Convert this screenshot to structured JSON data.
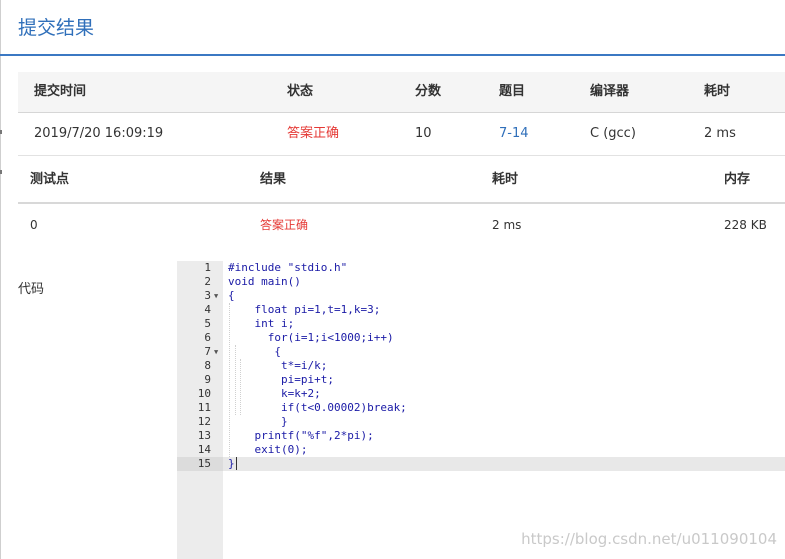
{
  "header": {
    "title": "提交结果"
  },
  "submission": {
    "columns": [
      "提交时间",
      "状态",
      "分数",
      "题目",
      "编译器",
      "耗时"
    ],
    "row": {
      "time": "2019/7/20 16:09:19",
      "status": "答案正确",
      "score": "10",
      "problem": "7-14",
      "compiler": "C (gcc)",
      "duration": "2 ms"
    }
  },
  "testcases": {
    "columns": [
      "测试点",
      "结果",
      "耗时",
      "内存"
    ],
    "rows": [
      {
        "id": "0",
        "result": "答案正确",
        "duration": "2 ms",
        "memory": "228 KB"
      }
    ]
  },
  "code": {
    "label": "代码",
    "active_line": 15,
    "lines": [
      {
        "n": "1",
        "text": "#include \"stdio.h\"",
        "fold": false
      },
      {
        "n": "2",
        "text": "void main()",
        "fold": false
      },
      {
        "n": "3",
        "text": "{",
        "fold": true
      },
      {
        "n": "4",
        "text": "    float pi=1,t=1,k=3;",
        "fold": false
      },
      {
        "n": "5",
        "text": "    int i;",
        "fold": false
      },
      {
        "n": "6",
        "text": "      for(i=1;i<1000;i++)",
        "fold": false
      },
      {
        "n": "7",
        "text": "       {",
        "fold": true
      },
      {
        "n": "8",
        "text": "        t*=i/k;",
        "fold": false
      },
      {
        "n": "9",
        "text": "        pi=pi+t;",
        "fold": false
      },
      {
        "n": "10",
        "text": "        k=k+2;",
        "fold": false
      },
      {
        "n": "11",
        "text": "        if(t<0.00002)break;",
        "fold": false
      },
      {
        "n": "12",
        "text": "        }",
        "fold": false
      },
      {
        "n": "13",
        "text": "    printf(\"%f\",2*pi);",
        "fold": false
      },
      {
        "n": "14",
        "text": "    exit(0);",
        "fold": false
      },
      {
        "n": "15",
        "text": "}",
        "fold": false
      }
    ]
  },
  "watermark": "https://blog.csdn.net/u011090104"
}
